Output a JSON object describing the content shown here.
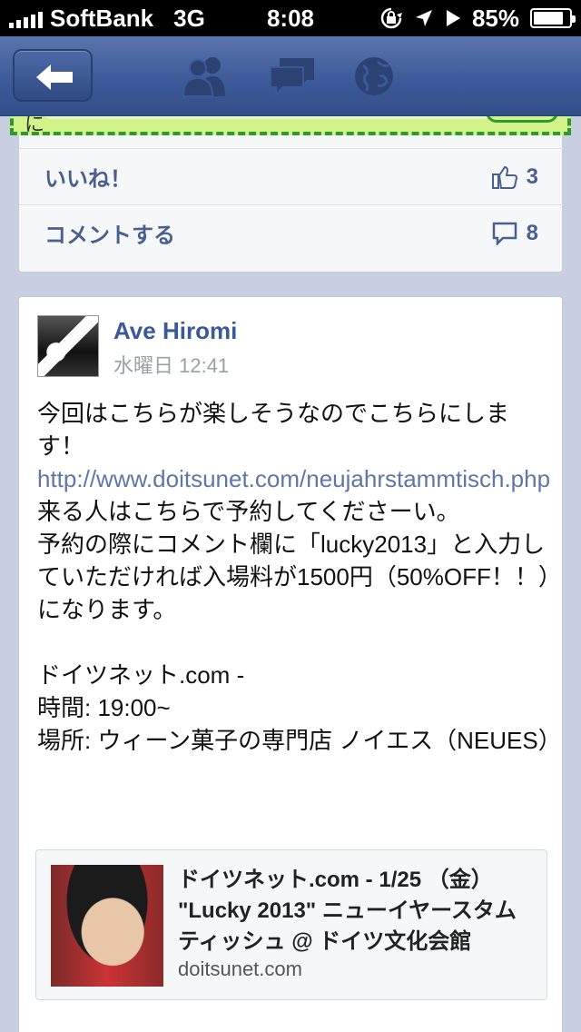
{
  "status_bar": {
    "carrier": "SoftBank",
    "network": "3G",
    "time": "8:08",
    "battery_percent": "85%",
    "battery_level": 0.85,
    "icons": [
      "signal-bars-icon",
      "rotation-lock-icon",
      "location-arrow-icon",
      "play-icon",
      "battery-icon"
    ]
  },
  "nav_bar": {
    "icons": [
      "back-arrow-icon",
      "friends-icon",
      "messages-icon",
      "globe-notifications-icon"
    ],
    "colors": {
      "bar": "#3b5998",
      "icon": "#2b4272"
    }
  },
  "prev_post": {
    "glyph": "に",
    "like_label": "いいね！",
    "like_count": "3",
    "comment_label": "コメントする",
    "comment_count": "8"
  },
  "post": {
    "author": "Ave Hiromi",
    "time": "水曜日 12:41",
    "lines": [
      "今回はこちらが楽しそうなのでこちらにします！",
      "http://www.doitsunet.com/neujahrstammtisch.php",
      "来る人はこちらで予約してくださーい。",
      "予約の際にコメント欄に「lucky2013」と入力していただければ入場料が1500円（50%OFF！！）になります。",
      "",
      "ドイツネット.com -",
      "時間: 19:00~",
      "場所: ウィーン菓子の専門店 ノイエス（NEUES）"
    ],
    "link_preview": {
      "title": "ドイツネット.com - 1/25 （金） \"Lucky 2013\" ニューイヤースタムティッシュ @ ドイツ文化会館",
      "domain": "doitsunet.com"
    }
  },
  "colors": {
    "facebook_blue": "#3b5998",
    "link": "#5f76a6",
    "action_text": "#4b5f8f",
    "background": "#c7cfe0",
    "highlight_green": "#d2f28a",
    "dashed_border": "#2e9a2e"
  }
}
